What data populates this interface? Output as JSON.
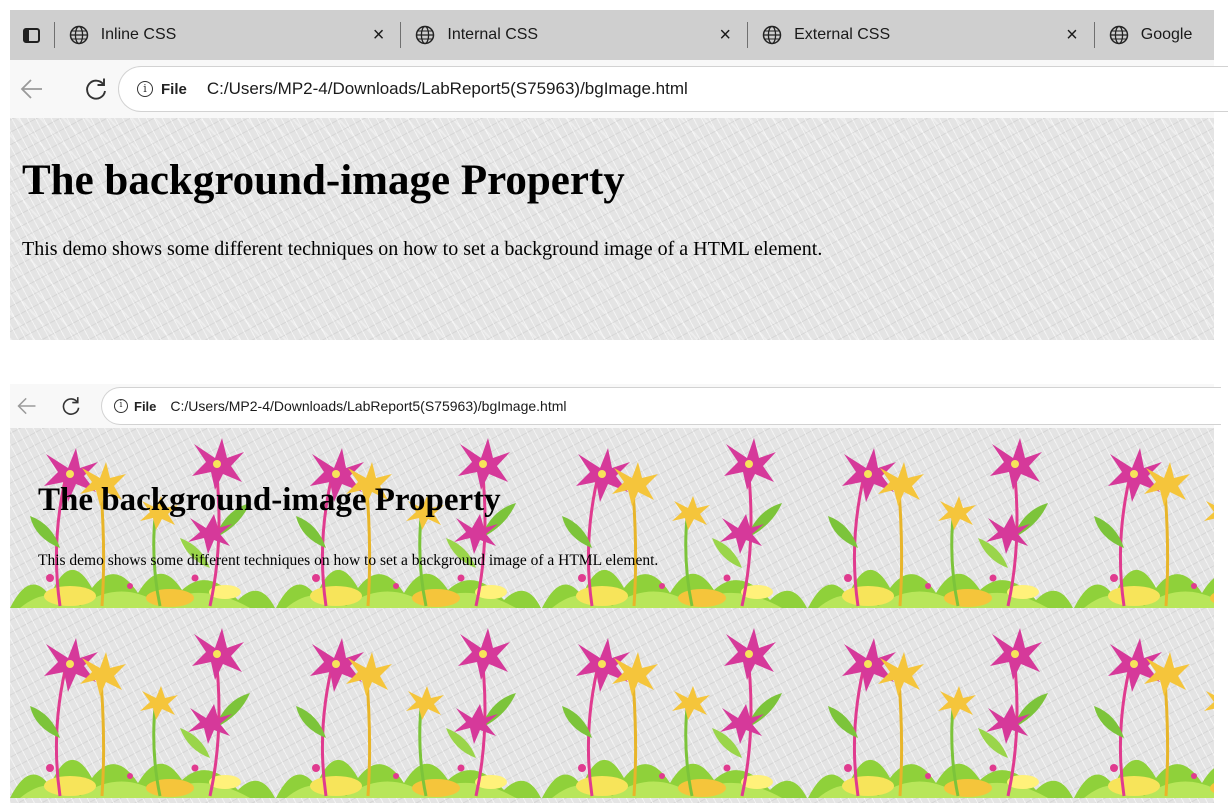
{
  "tabs": [
    {
      "title": "Inline CSS",
      "icon": "globe-icon"
    },
    {
      "title": "Internal CSS",
      "icon": "globe-icon"
    },
    {
      "title": "External CSS",
      "icon": "globe-icon"
    },
    {
      "title": "Google",
      "icon": "globe-icon"
    }
  ],
  "tab_close_glyph": "×",
  "address_bar": {
    "info_glyph": "i",
    "scheme_chip": "File",
    "url": "C:/Users/MP2-4/Downloads/LabReport5(S75963)/bgImage.html"
  },
  "page_top": {
    "heading": "The background-image Property",
    "paragraph": "This demo shows some different techniques on how to set a background image of a HTML element."
  },
  "page_bottom": {
    "heading": "The background-image Property",
    "paragraph": "This demo shows some different techniques on how to set a background image of a HTML element."
  },
  "colors": {
    "tab_strip": "#cfcfcf",
    "toolbar": "#f8f8f8",
    "page_background": "#e4e4e4",
    "flower_magenta": "#d6399a",
    "flower_yellow": "#f5c53b",
    "leaf_green": "#8fd13a"
  }
}
